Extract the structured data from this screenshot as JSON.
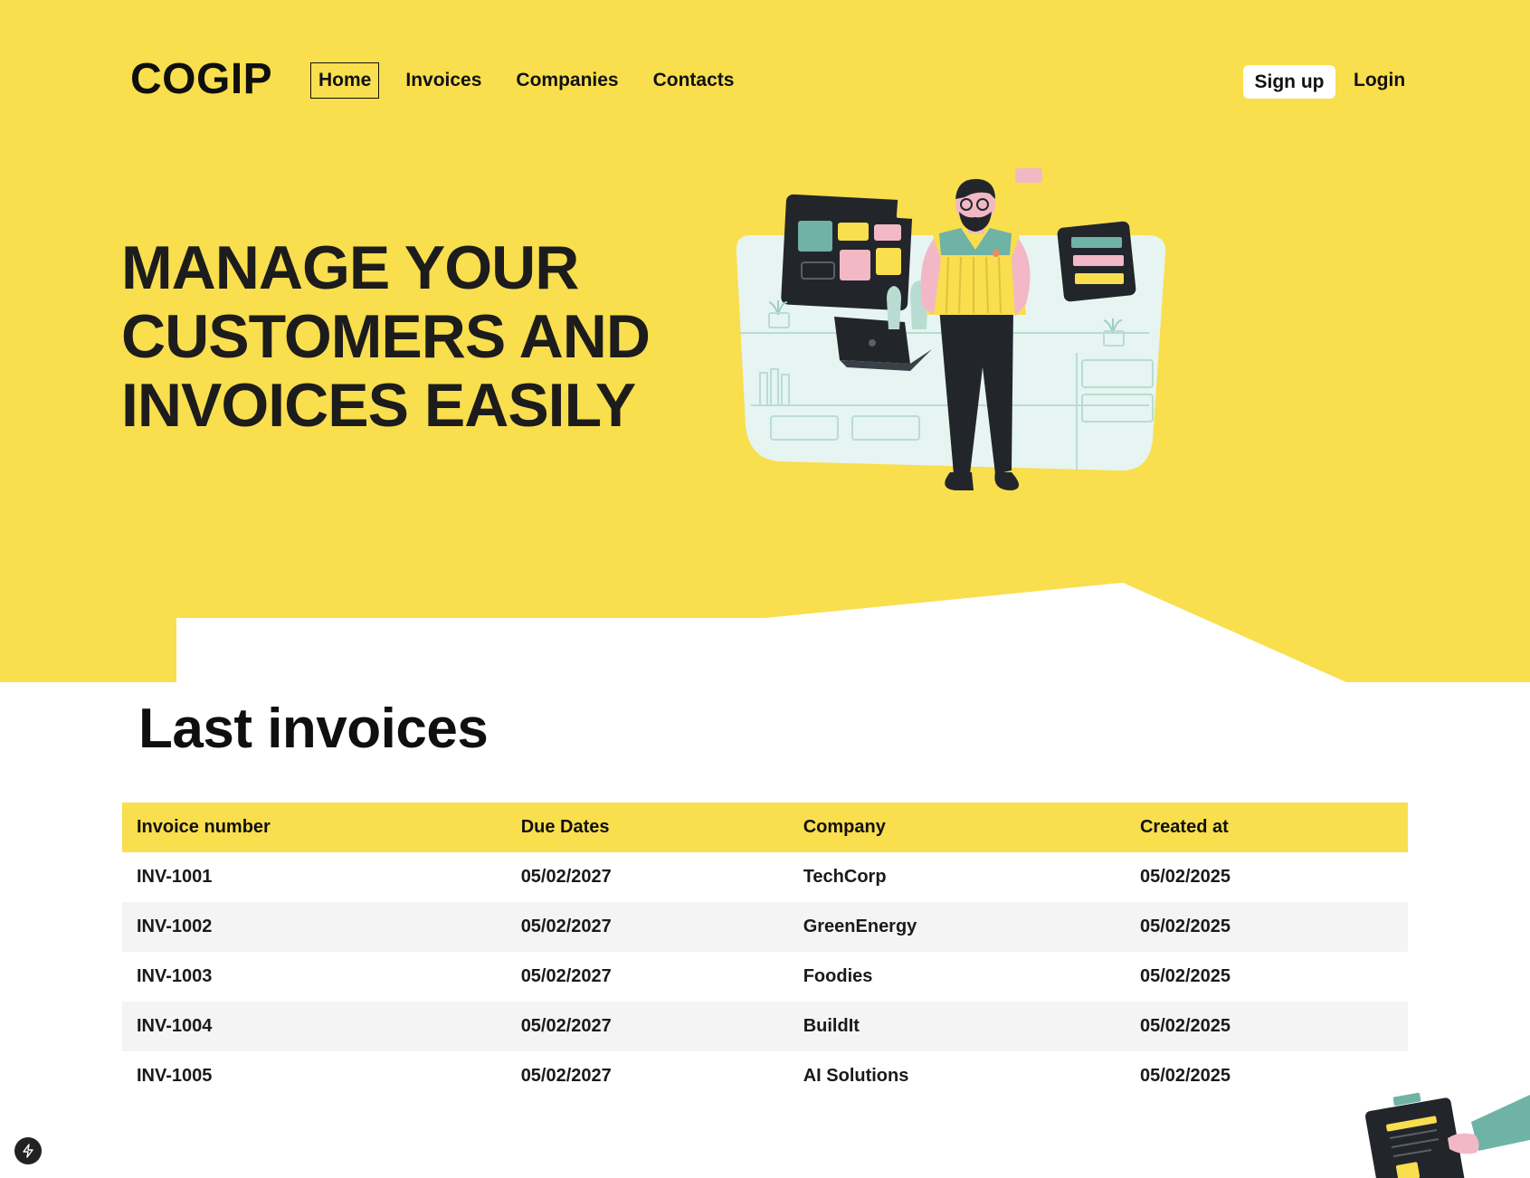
{
  "app": {
    "logo": "COGIP"
  },
  "nav": {
    "items": [
      {
        "label": "Home",
        "active": true
      },
      {
        "label": "Invoices",
        "active": false
      },
      {
        "label": "Companies",
        "active": false
      },
      {
        "label": "Contacts",
        "active": false
      }
    ]
  },
  "auth": {
    "signup_label": "Sign up",
    "login_label": "Login"
  },
  "hero": {
    "headline_lines": [
      "MANAGE YOUR",
      "CUSTOMERS AND",
      "INVOICES EASILY"
    ],
    "illustration_icon": "person-with-dashboards-illustration"
  },
  "invoices": {
    "title": "Last invoices",
    "columns": [
      "Invoice number",
      "Due Dates",
      "Company",
      "Created at"
    ],
    "rows": [
      [
        "INV-1001",
        "05/02/2027",
        "TechCorp",
        "05/02/2025"
      ],
      [
        "INV-1002",
        "05/02/2027",
        "GreenEnergy",
        "05/02/2025"
      ],
      [
        "INV-1003",
        "05/02/2027",
        "Foodies",
        "05/02/2025"
      ],
      [
        "INV-1004",
        "05/02/2027",
        "BuildIt",
        "05/02/2025"
      ],
      [
        "INV-1005",
        "05/02/2027",
        "AI Solutions",
        "05/02/2025"
      ]
    ]
  },
  "colors": {
    "brand_yellow": "#f9de4e",
    "text_dark": "#111111",
    "row_alt": "#f4f4f4",
    "illustration_teal": "#6fb3a6",
    "illustration_pink": "#f2b8c6"
  },
  "icons": {
    "dev_badge": "lightning-icon",
    "corner": "clipboard-hand-illustration"
  }
}
